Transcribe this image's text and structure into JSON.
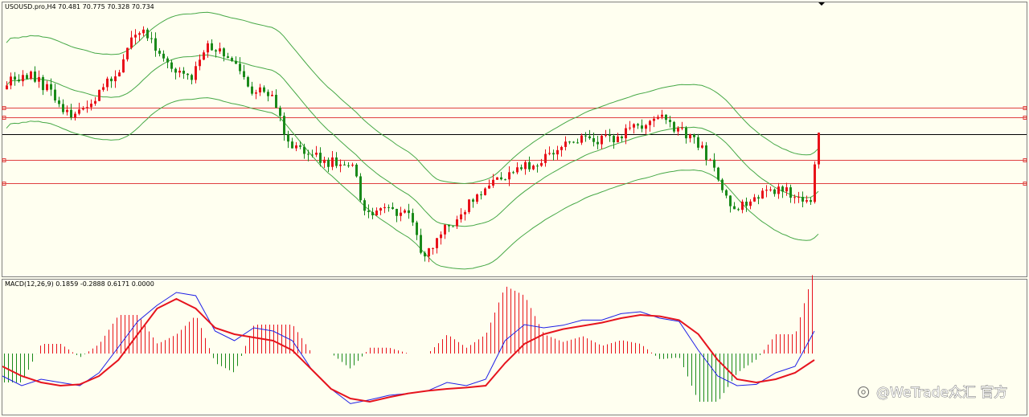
{
  "header": {
    "main_label": "USOUSD.pro,H4  70.481 70.775 70.328 70.734",
    "macd_label": "MACD(12,26,9) 0.1859 -0.2888 0.6171 0.0000"
  },
  "watermark": "@WeTrade众汇 官方",
  "colors": {
    "background": "#fffff0",
    "bull": "#e8121a",
    "bear": "#1a8a1a",
    "bands": "#46a846",
    "level_lines": "#e04040",
    "current_line": "#000000",
    "macd_line": "#1f1fe6",
    "signal_line": "#e6141e"
  },
  "chart_data": [
    {
      "type": "candlestick",
      "symbol": "USOUSD.pro",
      "timeframe": "H4",
      "ohlc_last": {
        "open": 70.481,
        "high": 70.775,
        "low": 70.328,
        "close": 70.734
      },
      "ylim": [
        63.3,
        77.4
      ],
      "bands_offset": 2.2,
      "levels": [
        72.0,
        71.5,
        69.3,
        68.1
      ],
      "current_level": 70.6,
      "anchors": [
        [
          0,
          73.4
        ],
        [
          6,
          73.6
        ],
        [
          10,
          73.0
        ],
        [
          16,
          71.5
        ],
        [
          22,
          72.5
        ],
        [
          28,
          74.0
        ],
        [
          32,
          76.0
        ],
        [
          36,
          75.5
        ],
        [
          40,
          74.2
        ],
        [
          46,
          73.4
        ],
        [
          50,
          75.3
        ],
        [
          56,
          74.5
        ],
        [
          60,
          73.0
        ],
        [
          66,
          72.8
        ],
        [
          70,
          70.0
        ],
        [
          80,
          69.2
        ],
        [
          86,
          69.2
        ],
        [
          89,
          66.6
        ],
        [
          94,
          66.8
        ],
        [
          100,
          66.5
        ],
        [
          104,
          64.2
        ],
        [
          108,
          65.5
        ],
        [
          114,
          66.8
        ],
        [
          120,
          68.0
        ],
        [
          126,
          68.7
        ],
        [
          132,
          69.2
        ],
        [
          138,
          70.0
        ],
        [
          144,
          70.4
        ],
        [
          150,
          70.3
        ],
        [
          156,
          71.0
        ],
        [
          162,
          71.5
        ],
        [
          166,
          71.0
        ],
        [
          172,
          70.1
        ],
        [
          176,
          68.8
        ],
        [
          180,
          66.8
        ],
        [
          186,
          67.2
        ],
        [
          190,
          67.7
        ],
        [
          196,
          67.6
        ],
        [
          200,
          67.2
        ],
        [
          202,
          70.7
        ]
      ],
      "series": [
        {
          "name": "MACD",
          "values": [
            -0.35,
            -0.5,
            -0.4,
            -0.45,
            -0.5,
            -0.3,
            0.1,
            0.5,
            0.75,
            0.95,
            0.9,
            0.35,
            0.2,
            0.4,
            0.35,
            0.2,
            -0.25,
            -0.55,
            -0.78,
            -0.72,
            -0.65,
            -0.62,
            -0.58,
            -0.45,
            -0.5,
            -0.4,
            0.2,
            0.45,
            0.4,
            0.44,
            0.52,
            0.52,
            0.62,
            0.65,
            0.55,
            0.5,
            0.05,
            -0.35,
            -0.5,
            -0.48,
            -0.3,
            -0.2,
            0.35
          ]
        },
        {
          "name": "Signal",
          "values": [
            -0.2,
            -0.35,
            -0.45,
            -0.5,
            -0.48,
            -0.35,
            -0.1,
            0.3,
            0.7,
            0.85,
            0.7,
            0.4,
            0.3,
            0.25,
            0.2,
            0.05,
            -0.25,
            -0.55,
            -0.7,
            -0.75,
            -0.68,
            -0.62,
            -0.58,
            -0.55,
            -0.53,
            -0.5,
            -0.15,
            0.15,
            0.3,
            0.38,
            0.43,
            0.48,
            0.55,
            0.6,
            0.58,
            0.52,
            0.3,
            -0.1,
            -0.4,
            -0.45,
            -0.4,
            -0.3,
            -0.1
          ]
        }
      ],
      "macd_ylim": [
        -0.95,
        1.15
      ]
    }
  ]
}
